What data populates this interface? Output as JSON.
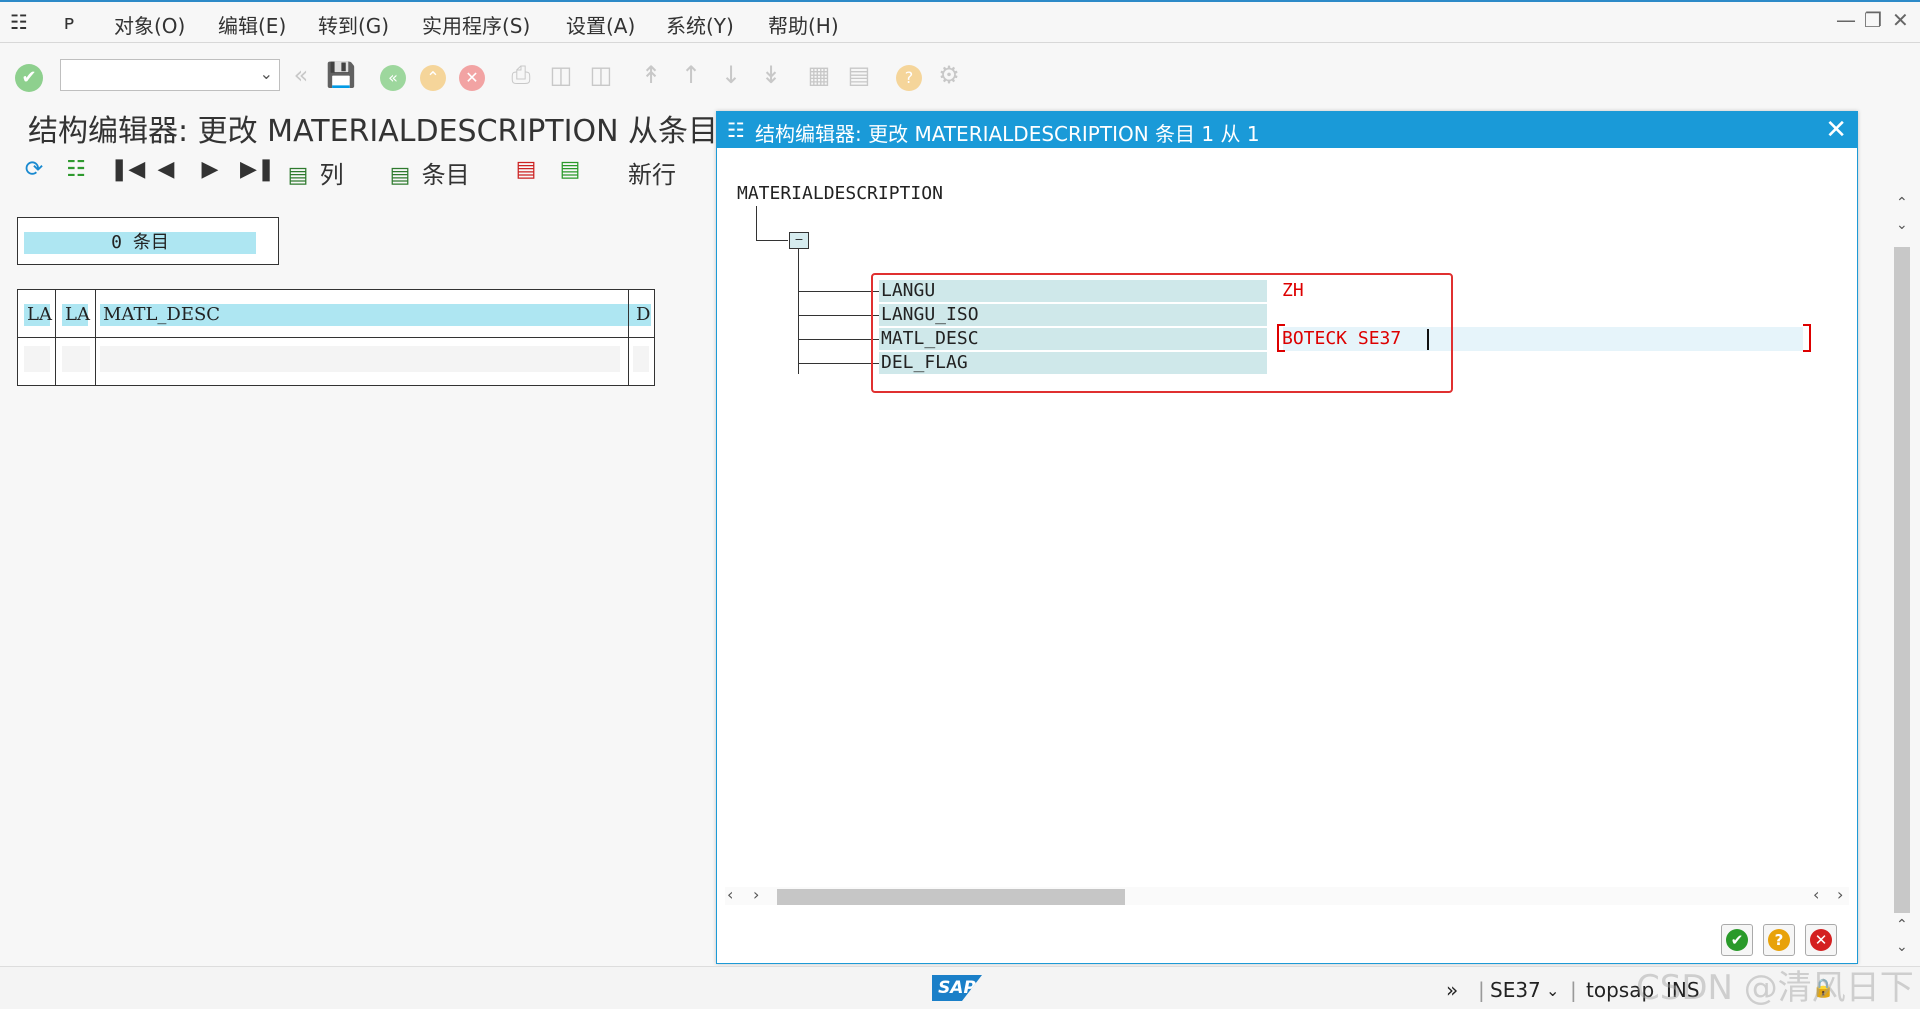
{
  "menu": {
    "items": [
      "对象(O)",
      "编辑(E)",
      "转到(G)",
      "实用程序(S)",
      "设置(A)",
      "系统(Y)",
      "帮助(H)"
    ]
  },
  "toolbar": {
    "command_field": ""
  },
  "page": {
    "title": "结构编辑器: 更改 MATERIALDESCRIPTION 从条目"
  },
  "app_toolbar": {
    "columns_label": "列",
    "entries_label": "条目",
    "new_row_label": "新行"
  },
  "left": {
    "entry_count": "0 条目",
    "table_headers": [
      "LA",
      "LA",
      "MATL_DESC",
      "D"
    ]
  },
  "dialog": {
    "title": "结构编辑器: 更改 MATERIALDESCRIPTION 条目 1 从 1",
    "root": "MATERIALDESCRIPTION",
    "fields": [
      {
        "label": "LANGU",
        "value": "ZH"
      },
      {
        "label": "LANGU_ISO",
        "value": ""
      },
      {
        "label": "MATL_DESC",
        "value": "BOTECK SE37"
      },
      {
        "label": "DEL_FLAG",
        "value": ""
      }
    ],
    "buttons": {
      "confirm_icon": "check-icon",
      "help_icon": "question-icon",
      "cancel_icon": "cancel-icon"
    }
  },
  "status": {
    "brand": "SAP",
    "transaction": "SE37",
    "server": "topsap",
    "mode": "INS"
  },
  "watermark": "CSDN @清风日下",
  "colors": {
    "accent": "#1a9ad8",
    "highlight": "#aee6f2",
    "field_label_bg": "#cfe8ea",
    "value_red": "#d00000",
    "redbox": "#e03030"
  }
}
